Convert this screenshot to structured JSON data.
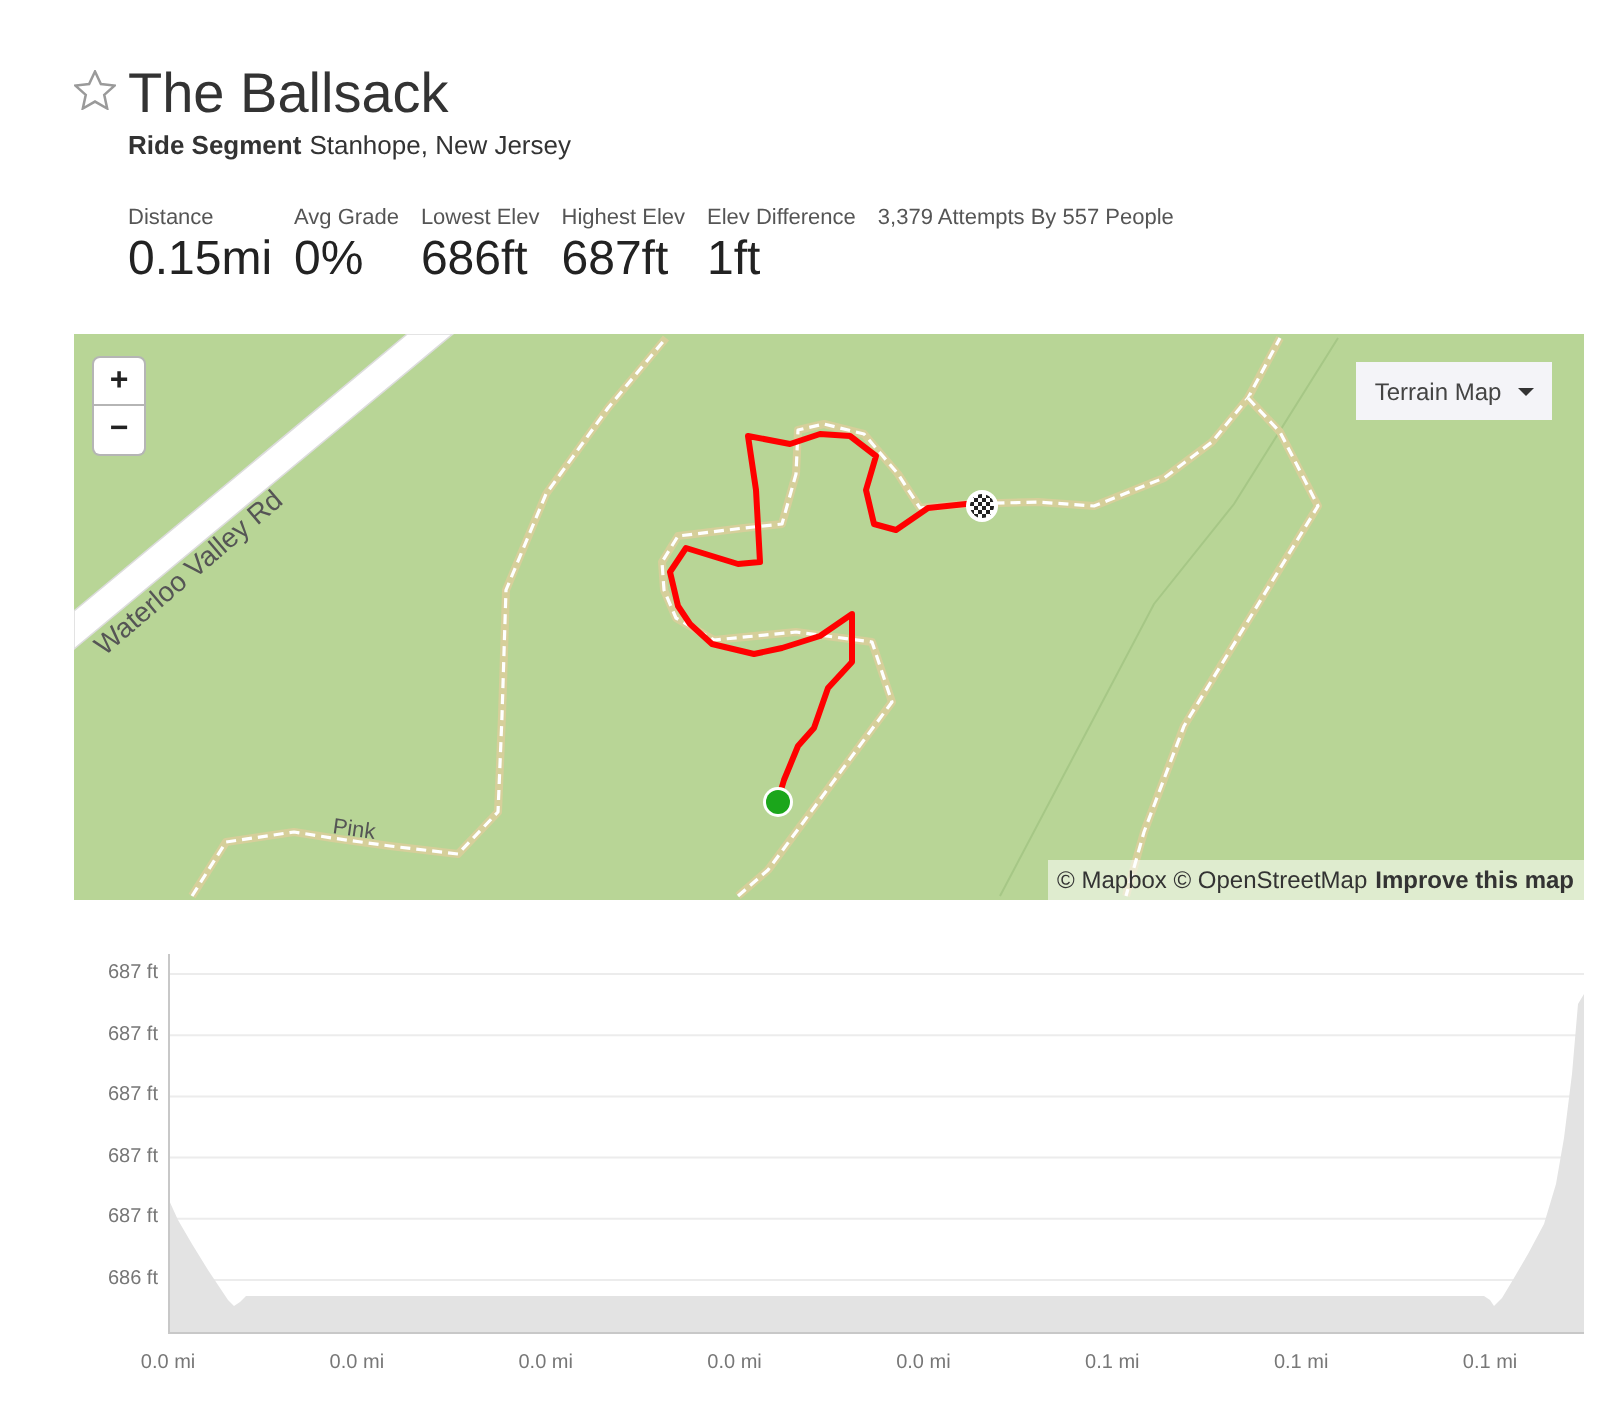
{
  "segment": {
    "title": "The Ballsack",
    "starred": false,
    "type": "Ride Segment",
    "location": "Stanhope, New Jersey"
  },
  "stats": [
    {
      "label": "Distance",
      "value": "0.15mi"
    },
    {
      "label": "Avg Grade",
      "value": "0%"
    },
    {
      "label": "Lowest Elev",
      "value": "686ft"
    },
    {
      "label": "Highest Elev",
      "value": "687ft"
    },
    {
      "label": "Elev Difference",
      "value": "1ft"
    },
    {
      "label": "3,379 Attempts By 557 People"
    }
  ],
  "map": {
    "zoom_in": "+",
    "zoom_out": "−",
    "layer_button": "Terrain Map",
    "road_label": "Waterloo Valley Rd",
    "trail_label": "Pink",
    "attribution": "© Mapbox © OpenStreetMap",
    "improve_link": "Improve this map"
  },
  "elevation_chart": {
    "y_labels": [
      "687 ft",
      "687 ft",
      "687 ft",
      "687 ft",
      "687 ft",
      "686 ft"
    ],
    "x_labels": [
      "0.0 mi",
      "0.0 mi",
      "0.0 mi",
      "0.0 mi",
      "0.0 mi",
      "0.1 mi",
      "0.1 mi",
      "0.1 mi"
    ]
  }
}
